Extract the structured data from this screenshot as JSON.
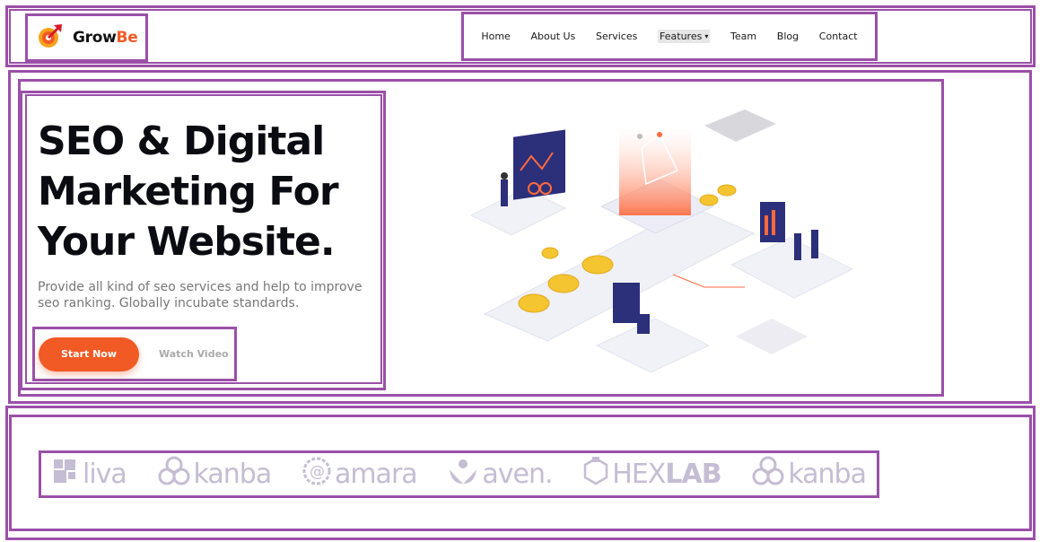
{
  "brand": {
    "name_part1": "Grow",
    "name_part2": "Be",
    "accent": "#f15a24",
    "icon": "growth-arrow-icon"
  },
  "nav": {
    "items": [
      "Home",
      "About Us",
      "Services",
      "Features",
      "Team",
      "Blog",
      "Contact"
    ],
    "dropdown_icon": "chevron-down-icon"
  },
  "hero": {
    "title_line1": "SEO & Digital",
    "title_line2": "Marketing For",
    "title_line3": "Your Website.",
    "subtitle": "Provide all kind of seo services and help to improve seo ranking. Globally incubate standards.",
    "primary_button": "Start Now",
    "secondary_button": "Watch Video"
  },
  "logos": {
    "items": [
      {
        "text": "liva",
        "icon": "blocks-icon"
      },
      {
        "text": "kanba",
        "icon": "rings-icon"
      },
      {
        "text": "amara",
        "icon": "at-badge-icon"
      },
      {
        "text": "aven.",
        "icon": "leaf-person-icon"
      },
      {
        "text_a": "HEX",
        "text_b": "LAB",
        "icon": "hexagon-icon"
      },
      {
        "text": "kanba",
        "icon": "rings-icon"
      }
    ],
    "color": "#c4bdd3"
  },
  "frame_color": "#9b4fa8"
}
